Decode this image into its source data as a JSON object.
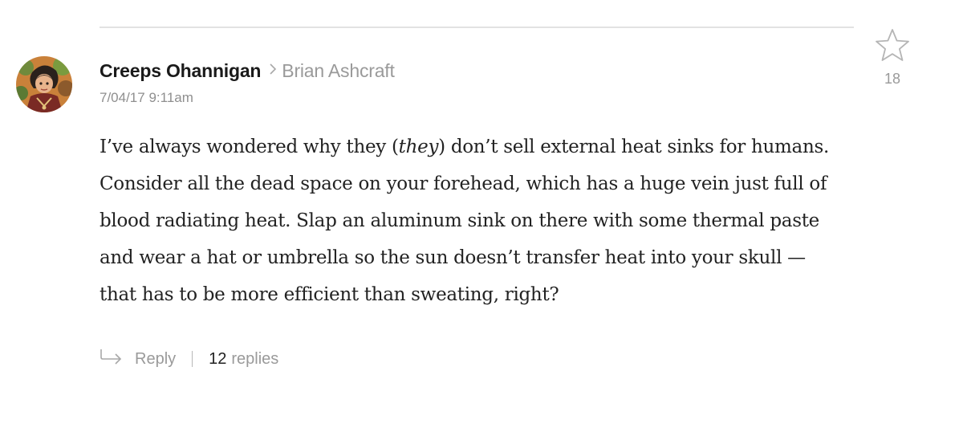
{
  "comment": {
    "author": "Creeps Ohannigan",
    "reply_to": "Brian Ashcraft",
    "timestamp": "7/04/17 9:11am",
    "star_count": "18",
    "body": {
      "line1_before": "I’ve always wondered why they (",
      "line1_em": "they",
      "line1_after": ") don’t sell external heat sinks for humans.",
      "line2": "Consider all the dead space on your forehead, which has a huge vein just full of",
      "line3": "blood radiating heat. Slap an aluminum sink on there with some thermal paste",
      "line4": "and wear a hat or umbrella so the sun doesn’t transfer heat into your skull —",
      "line5": "that has to be more efficient than sweating, right?"
    },
    "footer": {
      "reply_label": "Reply",
      "reply_count": "12",
      "replies_label": "replies"
    }
  },
  "icons": {
    "star": "star-icon",
    "reply_arrow": "reply-arrow-icon",
    "chevron": "chevron-right-icon"
  },
  "colors": {
    "muted_text": "#9a9a9a",
    "body_text": "#222222",
    "divider": "#e2e2e2"
  }
}
